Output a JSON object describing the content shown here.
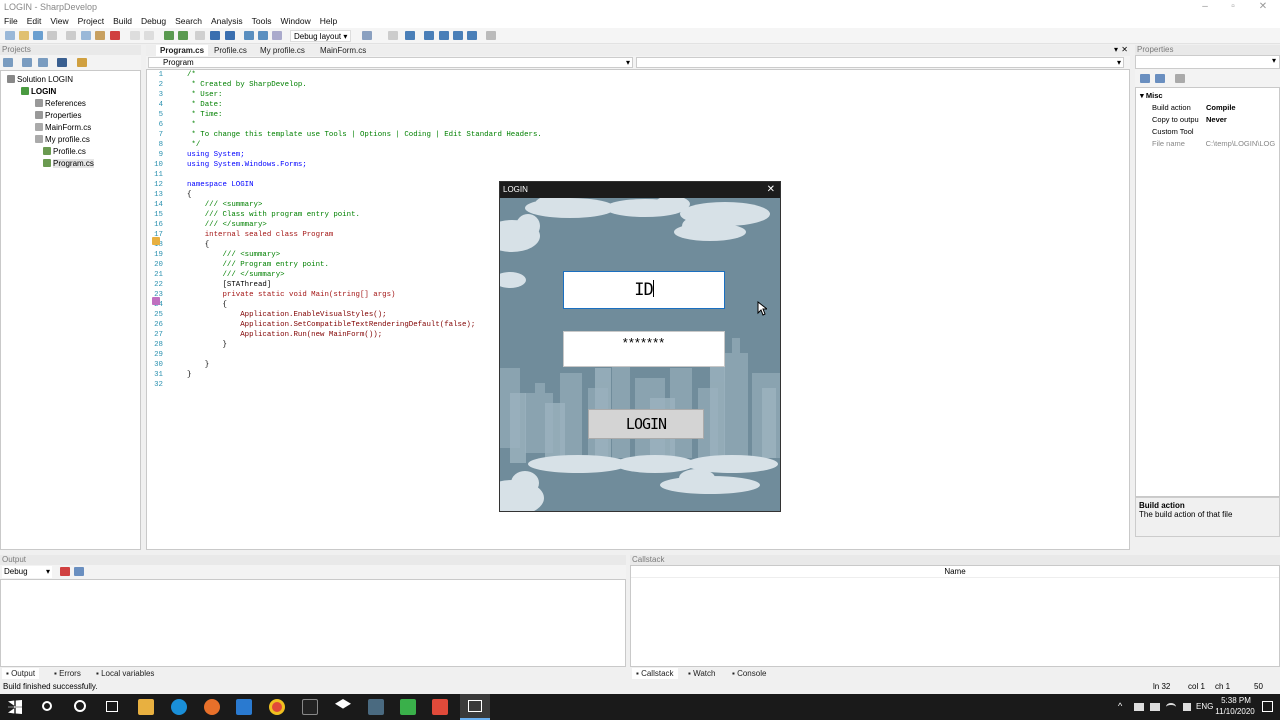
{
  "window": {
    "title": "LOGIN - SharpDevelop"
  },
  "menu": [
    "File",
    "Edit",
    "View",
    "Project",
    "Build",
    "Debug",
    "Search",
    "Analysis",
    "Tools",
    "Window",
    "Help"
  ],
  "toolbar": {
    "layout_label": "Debug layout"
  },
  "projects": {
    "header": "Projects",
    "items": [
      "Solution LOGIN",
      "LOGIN",
      "References",
      "Properties",
      "MainForm.cs",
      "My profile.cs",
      "Profile.cs",
      "Program.cs"
    ]
  },
  "editor": {
    "tabs": [
      "Program.cs",
      "Profile.cs",
      "My profile.cs",
      "MainForm.cs"
    ],
    "class_combo": "Program",
    "lines": [
      "/*",
      " * Created by SharpDevelop.",
      " * User:",
      " * Date:",
      " * Time:",
      " *",
      " * To change this template use Tools | Options | Coding | Edit Standard Headers.",
      " */",
      "using System;",
      "using System.Windows.Forms;",
      "",
      "namespace LOGIN",
      "{",
      "    /// <summary>",
      "    /// Class with program entry point.",
      "    /// </summary>",
      "    internal sealed class Program",
      "    {",
      "        /// <summary>",
      "        /// Program entry point.",
      "        /// </summary>",
      "        [STAThread]",
      "        private static void Main(string[] args)",
      "        {",
      "            Application.EnableVisualStyles();",
      "            Application.SetCompatibleTextRenderingDefault(false);",
      "            Application.Run(new MainForm());",
      "        }",
      "",
      "    }",
      "}",
      ""
    ]
  },
  "properties": {
    "header": "Properties",
    "category": "Misc",
    "rows": [
      {
        "k": "Build action",
        "v": "Compile"
      },
      {
        "k": "Copy to outpu",
        "v": "Never"
      },
      {
        "k": "Custom Tool",
        "v": ""
      },
      {
        "k": "File name",
        "v": "C:\\temp\\LOGIN\\LOG"
      }
    ],
    "desc_title": "Build action",
    "desc_text": "The build action of that file"
  },
  "output": {
    "header": "Output",
    "combo": "Debug",
    "tabs": [
      "Output",
      "Errors",
      "Local variables"
    ]
  },
  "callstack": {
    "header": "Callstack",
    "col": "Name",
    "tabs": [
      "Callstack",
      "Watch",
      "Console"
    ]
  },
  "status": {
    "message": "Build finished successfully.",
    "ln": "ln 32",
    "col": "col 1",
    "ch": "ch 1",
    "num": "50"
  },
  "login": {
    "title": "LOGIN",
    "id_value": "ID",
    "password_value": "*******",
    "button": "LOGIN"
  },
  "taskbar": {
    "lang": "ENG",
    "time": "5:38 PM",
    "date": "11/10/2020"
  },
  "colors": {
    "login_bg": "#708c9b",
    "accent": "#0078d7"
  }
}
